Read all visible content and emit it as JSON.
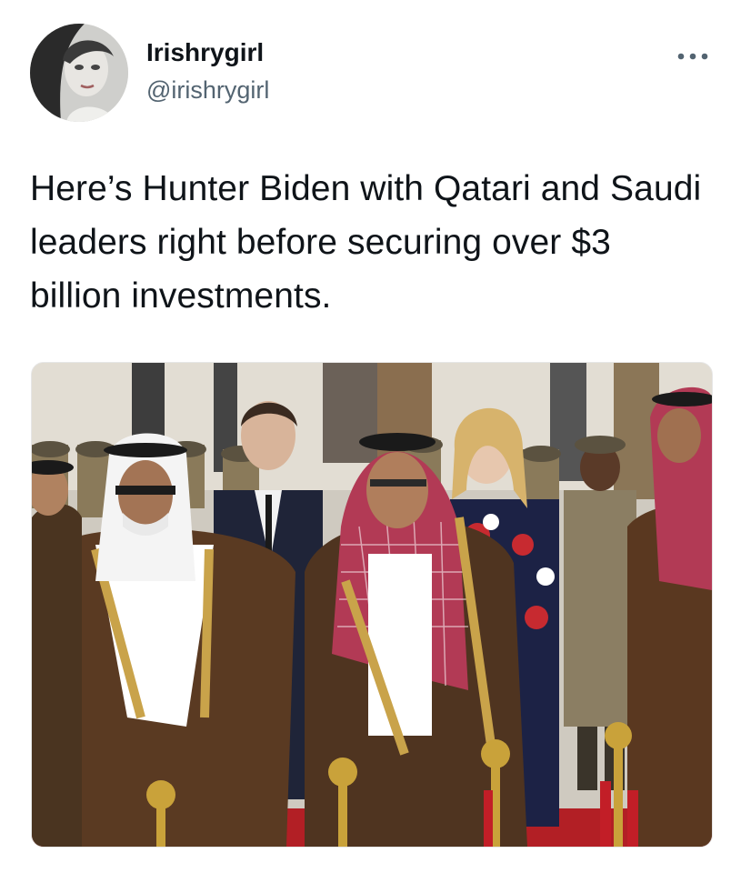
{
  "tweet": {
    "author": {
      "display_name": "Irishrygirl",
      "handle": "@irishrygirl",
      "avatar_icon": "profile-avatar"
    },
    "more_icon": "more-horizontal-icon",
    "text": "Here’s Hunter Biden with Qatari and Saudi leaders right before securing over $3 billion investments.",
    "media": {
      "kind": "photo"
    }
  },
  "colors": {
    "text": "#0f1419",
    "secondary": "#536471",
    "background": "#ffffff"
  }
}
